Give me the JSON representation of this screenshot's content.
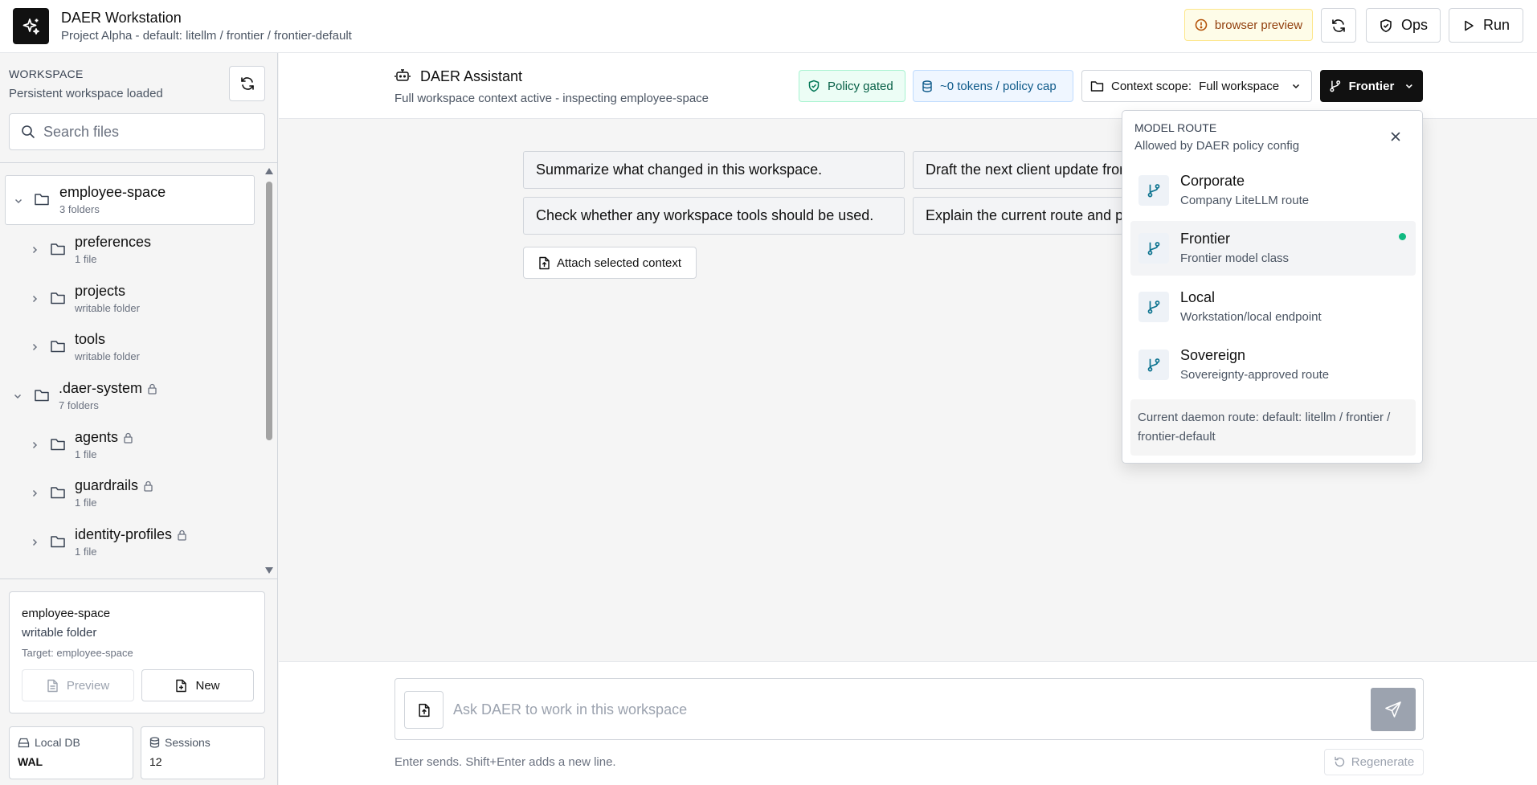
{
  "app": {
    "title": "DAER Workstation",
    "subtitle": "Project Alpha - default: litellm / frontier / frontier-default"
  },
  "topbar": {
    "preview_badge": "browser preview",
    "ops_label": "Ops",
    "run_label": "Run"
  },
  "sidebar": {
    "heading": "WORKSPACE",
    "status": "Persistent workspace loaded",
    "search_placeholder": "Search files",
    "tree": [
      {
        "name": "employee-space",
        "meta": "3 folders",
        "level": 0,
        "expanded": true,
        "locked": false,
        "selected": true
      },
      {
        "name": "preferences",
        "meta": "1 file",
        "level": 1,
        "expanded": false,
        "locked": false
      },
      {
        "name": "projects",
        "meta": "writable folder",
        "level": 1,
        "expanded": false,
        "locked": false
      },
      {
        "name": "tools",
        "meta": "writable folder",
        "level": 1,
        "expanded": false,
        "locked": false
      },
      {
        "name": ".daer-system",
        "meta": "7 folders",
        "level": 0,
        "expanded": true,
        "locked": true
      },
      {
        "name": "agents",
        "meta": "1 file",
        "level": 1,
        "expanded": false,
        "locked": true
      },
      {
        "name": "guardrails",
        "meta": "1 file",
        "level": 1,
        "expanded": false,
        "locked": true
      },
      {
        "name": "identity-profiles",
        "meta": "1 file",
        "level": 1,
        "expanded": false,
        "locked": true
      }
    ],
    "selection": {
      "name": "employee-space",
      "kind": "writable folder",
      "target": "Target: employee-space",
      "preview_label": "Preview",
      "new_label": "New"
    },
    "stats": {
      "db_label": "Local DB",
      "db_value": "WAL",
      "sessions_label": "Sessions",
      "sessions_value": "12"
    }
  },
  "assistant": {
    "title": "DAER Assistant",
    "subtitle": "Full workspace context active - inspecting employee-space",
    "policy_chip": "Policy gated",
    "tokens_chip": "~0 tokens / policy cap",
    "context_label": "Context scope:",
    "context_value": "Full workspace",
    "model_button": "Frontier"
  },
  "suggestions": [
    "Summarize what changed in this workspace.",
    "Draft the next client update from",
    "Check whether any workspace tools should be used.",
    "Explain the current route and p"
  ],
  "attach_label": "Attach selected context",
  "composer": {
    "placeholder": "Ask DAER to work in this workspace",
    "hint": "Enter sends. Shift+Enter adds a new line.",
    "regenerate_label": "Regenerate"
  },
  "model_route": {
    "heading": "MODEL ROUTE",
    "subheading": "Allowed by DAER policy config",
    "routes": [
      {
        "name": "Corporate",
        "desc": "Company LiteLLM route",
        "active": false
      },
      {
        "name": "Frontier",
        "desc": "Frontier model class",
        "active": true
      },
      {
        "name": "Local",
        "desc": "Workstation/local endpoint",
        "active": false
      },
      {
        "name": "Sovereign",
        "desc": "Sovereignty-approved route",
        "active": false
      }
    ],
    "current": "Current daemon route: default: litellm / frontier / frontier-default"
  },
  "colors": {
    "accent_dark": "#111111",
    "policy_green": "#065f46",
    "tokens_blue": "#0e5a8a",
    "active_dot": "#10b981",
    "route_icon": "#0e7490"
  }
}
